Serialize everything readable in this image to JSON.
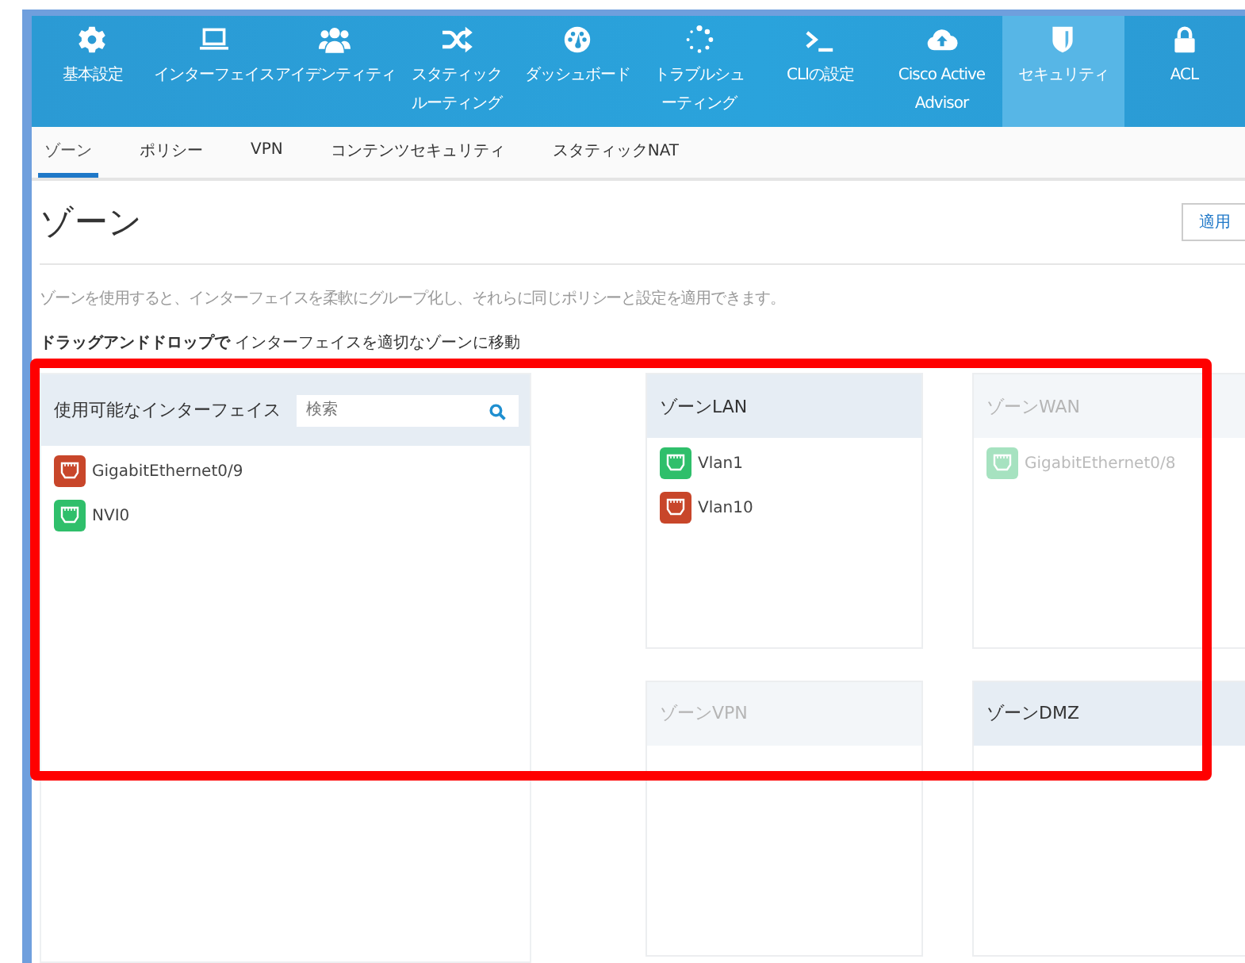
{
  "nav": [
    {
      "label": "基本設定",
      "selected": false
    },
    {
      "label": "インターフェイス",
      "selected": false
    },
    {
      "label": "アイデンティティ",
      "selected": false
    },
    {
      "label": "スタティックルーティング",
      "selected": false
    },
    {
      "label": "ダッシュボード",
      "selected": false
    },
    {
      "label": "トラブルシューティング",
      "selected": false
    },
    {
      "label": "CLIの設定",
      "selected": false
    },
    {
      "label": "Cisco Active Advisor",
      "selected": false
    },
    {
      "label": "セキュリティ",
      "selected": true
    },
    {
      "label": "ACL",
      "selected": false
    }
  ],
  "tabs": [
    {
      "label": "ゾーン",
      "selected": true
    },
    {
      "label": "ポリシー",
      "selected": false
    },
    {
      "label": "VPN",
      "selected": false
    },
    {
      "label": "コンテンツセキュリティ",
      "selected": false
    },
    {
      "label": "スタティックNAT",
      "selected": false
    }
  ],
  "page": {
    "title": "ゾーン",
    "apply_button": "適用",
    "description": "ゾーンを使用すると、インターフェイスを柔軟にグループ化し、それらに同じポリシーと設定を適用できます。",
    "instruction": "**ドラッグアンドドロップで** インターフェイスを適切なゾーンに移動"
  },
  "available": {
    "title": "使用可能なインターフェイス",
    "search": {
      "placeholder": "検索"
    },
    "interfaces": [
      {
        "name": "GigabitEthernet0/9",
        "color": "#c8462a"
      },
      {
        "name": "NVI0",
        "color": "#2fbf6b"
      }
    ]
  },
  "zones": [
    {
      "name": "ゾーンLAN",
      "disabled": false,
      "interfaces": [
        {
          "name": "Vlan1",
          "color": "#2fbf6b"
        },
        {
          "name": "Vlan10",
          "color": "#c8462a"
        }
      ]
    },
    {
      "name": "ゾーンWAN",
      "disabled": true,
      "interfaces": [
        {
          "name": "GigabitEthernet0/8",
          "color": "#a6e2c0"
        }
      ]
    },
    {
      "name": "ゾーンVPN",
      "disabled": true
    },
    {
      "name": "ゾーンDMZ",
      "disabled": false
    }
  ]
}
